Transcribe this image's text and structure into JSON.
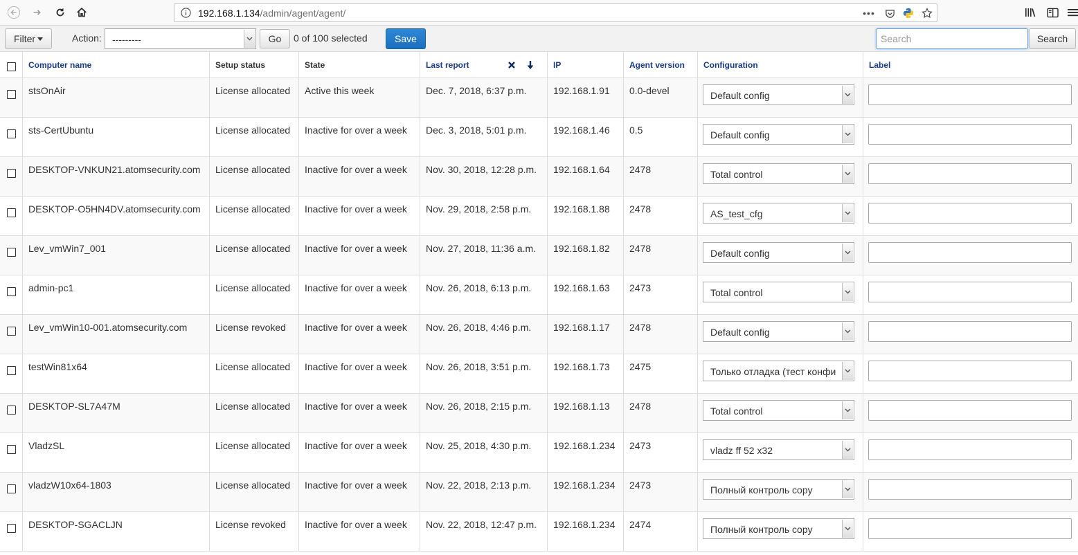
{
  "browser": {
    "url_host": "192.168.1.134",
    "url_path": "/admin/agent/agent/",
    "menu_dots": "•••"
  },
  "toolbar": {
    "filter_label": "Filter",
    "action_label": "Action:",
    "action_value": "---------",
    "go_label": "Go",
    "selected_count": "0 of 100 selected",
    "save_label": "Save",
    "search_placeholder": "Search",
    "search_button": "Search"
  },
  "table": {
    "columns": {
      "computer_name": "Computer name",
      "setup_status": "Setup status",
      "state": "State",
      "last_report": "Last report",
      "ip": "IP",
      "agent_version": "Agent version",
      "configuration": "Configuration",
      "label": "Label"
    },
    "rows": [
      {
        "name": "stsOnAir",
        "setup": "License allocated",
        "state": "Active this week",
        "last_report": "Dec. 7, 2018, 6:37 p.m.",
        "ip": "192.168.1.91",
        "version": "0.0-devel",
        "config": "Default config",
        "label": ""
      },
      {
        "name": "sts-CertUbuntu",
        "setup": "License allocated",
        "state": "Inactive for over a week",
        "last_report": "Dec. 3, 2018, 5:01 p.m.",
        "ip": "192.168.1.46",
        "version": "0.5",
        "config": "Default config",
        "label": ""
      },
      {
        "name": "DESKTOP-VNKUN21.atomsecurity.com",
        "setup": "License allocated",
        "state": "Inactive for over a week",
        "last_report": "Nov. 30, 2018, 12:28 p.m.",
        "ip": "192.168.1.64",
        "version": "2478",
        "config": "Total control",
        "label": ""
      },
      {
        "name": "DESKTOP-O5HN4DV.atomsecurity.com",
        "setup": "License allocated",
        "state": "Inactive for over a week",
        "last_report": "Nov. 29, 2018, 2:58 p.m.",
        "ip": "192.168.1.88",
        "version": "2478",
        "config": "AS_test_cfg",
        "label": ""
      },
      {
        "name": "Lev_vmWin7_001",
        "setup": "License allocated",
        "state": "Inactive for over a week",
        "last_report": "Nov. 27, 2018, 11:36 a.m.",
        "ip": "192.168.1.82",
        "version": "2478",
        "config": "Default config",
        "label": ""
      },
      {
        "name": "admin-pc1",
        "setup": "License allocated",
        "state": "Inactive for over a week",
        "last_report": "Nov. 26, 2018, 6:13 p.m.",
        "ip": "192.168.1.63",
        "version": "2473",
        "config": "Total control",
        "label": ""
      },
      {
        "name": "Lev_vmWin10-001.atomsecurity.com",
        "setup": "License revoked",
        "state": "Inactive for over a week",
        "last_report": "Nov. 26, 2018, 4:46 p.m.",
        "ip": "192.168.1.17",
        "version": "2478",
        "config": "Default config",
        "label": ""
      },
      {
        "name": "testWin81x64",
        "setup": "License allocated",
        "state": "Inactive for over a week",
        "last_report": "Nov. 26, 2018, 3:51 p.m.",
        "ip": "192.168.1.73",
        "version": "2475",
        "config": "Только отладка (тест конфи",
        "label": ""
      },
      {
        "name": "DESKTOP-SL7A47M",
        "setup": "License allocated",
        "state": "Inactive for over a week",
        "last_report": "Nov. 26, 2018, 2:15 p.m.",
        "ip": "192.168.1.13",
        "version": "2478",
        "config": "Total control",
        "label": ""
      },
      {
        "name": "VladzSL",
        "setup": "License allocated",
        "state": "Inactive for over a week",
        "last_report": "Nov. 25, 2018, 4:30 p.m.",
        "ip": "192.168.1.234",
        "version": "2473",
        "config": "vladz ff 52 x32",
        "label": ""
      },
      {
        "name": "vladzW10x64-1803",
        "setup": "License allocated",
        "state": "Inactive for over a week",
        "last_report": "Nov. 22, 2018, 2:13 p.m.",
        "ip": "192.168.1.234",
        "version": "2473",
        "config": "Полный контроль copy",
        "label": ""
      },
      {
        "name": "DESKTOP-SGACLJN",
        "setup": "License revoked",
        "state": "Inactive for over a week",
        "last_report": "Nov. 22, 2018, 12:47 p.m.",
        "ip": "192.168.1.234",
        "version": "2474",
        "config": "Полный контроль copy",
        "label": ""
      }
    ]
  },
  "colors": {
    "header_link": "#1a3a86",
    "primary_button": "#1d6fc0",
    "row_alt": "#f9f9f9"
  }
}
